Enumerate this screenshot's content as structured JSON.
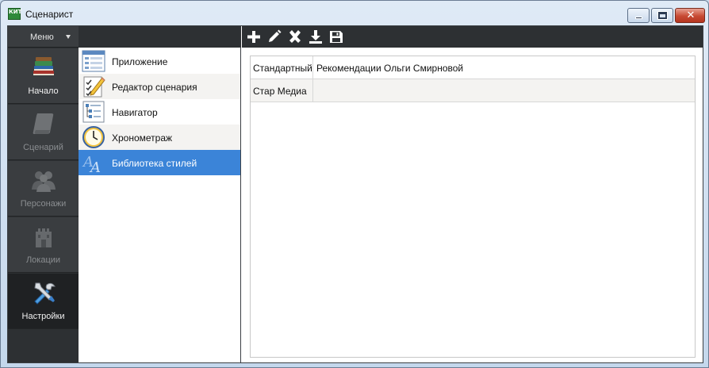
{
  "window": {
    "title": "Сценарист",
    "app_icon_text": "КИТ"
  },
  "sidebar": {
    "menu_label": "Меню",
    "items": [
      {
        "label": "Начало",
        "icon": "books-icon"
      },
      {
        "label": "Сценарий",
        "icon": "scroll-icon"
      },
      {
        "label": "Персонажи",
        "icon": "people-icon"
      },
      {
        "label": "Локации",
        "icon": "castle-icon"
      },
      {
        "label": "Настройки",
        "icon": "tools-icon",
        "active": true
      }
    ]
  },
  "modules": {
    "items": [
      {
        "label": "Приложение",
        "icon": "application-icon"
      },
      {
        "label": "Редактор сценария",
        "icon": "editor-icon"
      },
      {
        "label": "Навигатор",
        "icon": "navigator-icon"
      },
      {
        "label": "Хронометраж",
        "icon": "clock-icon"
      },
      {
        "label": "Библиотека стилей",
        "icon": "styles-icon",
        "selected": true
      }
    ]
  },
  "toolbar": {
    "tools": [
      "add-icon",
      "edit-icon",
      "delete-icon",
      "download-icon",
      "save-icon"
    ]
  },
  "styles_table": {
    "rows": [
      {
        "name": "Стандартный",
        "description": "Рекомендации Ольги Смирновой"
      },
      {
        "name": "Стар Медиа",
        "description": ""
      }
    ]
  },
  "colors": {
    "sidebar_bg": "#3a3d40",
    "sidebar_active": "#1f2123",
    "selection": "#3b84d8",
    "close_button": "#c74a33"
  }
}
